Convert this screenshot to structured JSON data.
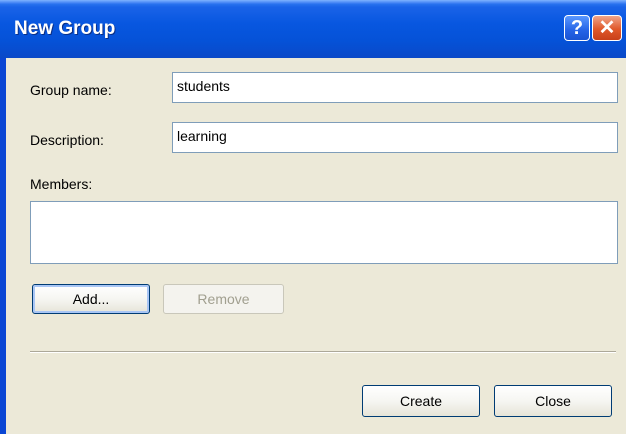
{
  "window": {
    "title": "New Group",
    "help_glyph": "?",
    "close_glyph": "✕"
  },
  "form": {
    "group_name_label": "Group name:",
    "group_name_value": "students",
    "description_label": "Description:",
    "description_value": "learning",
    "members_label": "Members:",
    "members_value": ""
  },
  "buttons": {
    "add": "Add...",
    "remove": "Remove",
    "create": "Create",
    "close": "Close"
  },
  "icons": {
    "help": "help-icon",
    "close": "close-icon"
  },
  "colors": {
    "titlebar": "#0553d9",
    "client_bg": "#ece9d8",
    "close_button": "#e0582a"
  }
}
